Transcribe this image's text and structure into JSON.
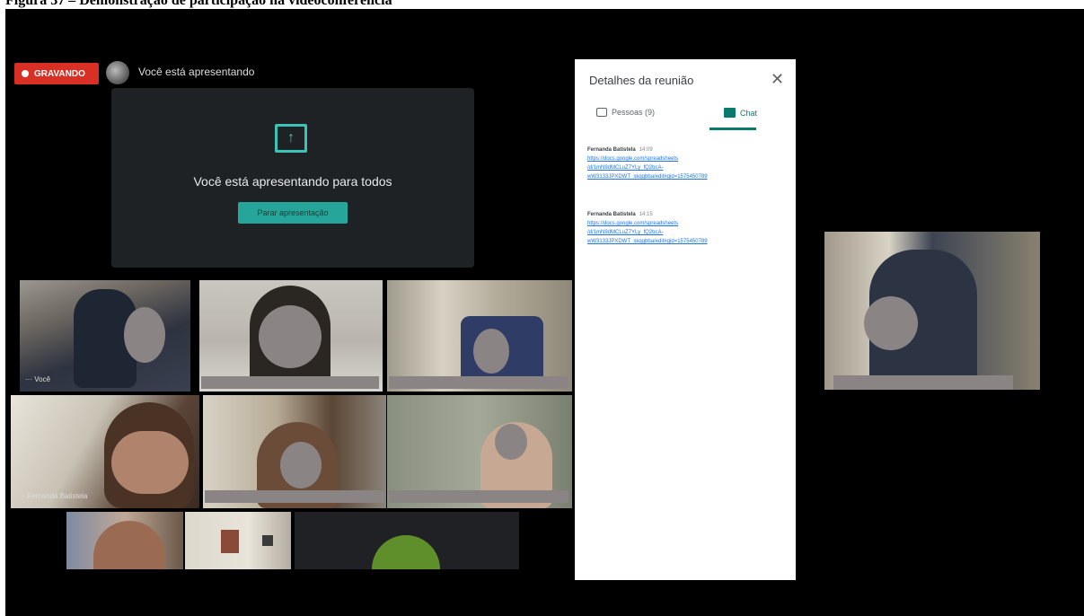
{
  "caption": "Figura 37 – Demonstração de participação na videoconferência",
  "topbar": {
    "recording_label": "GRAVANDO",
    "presenting_status": "Você está apresentando"
  },
  "presentation": {
    "message": "Você está apresentando para todos",
    "stop_button": "Parar apresentação",
    "icon": "present-to-all-icon"
  },
  "tiles": {
    "self_label": "Você",
    "participant_label": "Fernanda Batistela"
  },
  "meeting_panel": {
    "title": "Detalhes da reunião",
    "close_icon": "close-icon",
    "tab_people": "Pessoas (9)",
    "tab_chat": "Chat",
    "messages": [
      {
        "author": "Fernanda Batistela",
        "time": "14:09",
        "link": "https://docs.google.com/spreadsheets\n/d/1mN9dMCLuZ7YLy_fQ2bcA-\nwW3133JPXDWT_skqqbba/edit#gid=1575450789"
      },
      {
        "author": "Fernanda Batistela",
        "time": "14:15",
        "link": "https://docs.google.com/spreadsheets\n/d/1mN9dMCLuZ7YLy_fQ2bcA-\nwW3133JPXDWT_skqqbba/edit#gid=1575450789"
      }
    ]
  },
  "colors": {
    "recording_red": "#d93025",
    "accent_teal": "#26a69a",
    "chat_green": "#0b7a6e",
    "link_blue": "#1a73e8",
    "blur_gray": "#8a8484"
  }
}
